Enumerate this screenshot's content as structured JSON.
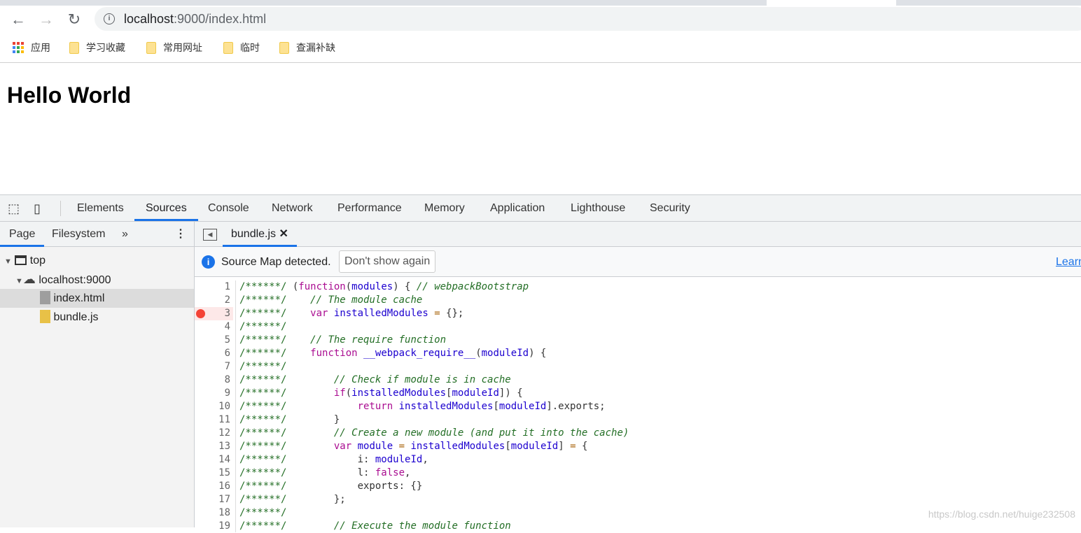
{
  "browser": {
    "url_host": "localhost",
    "url_rest": ":9000/index.html",
    "bookmarks": [
      {
        "label": "应用",
        "icon": "apps-icon"
      },
      {
        "label": "学习收藏",
        "icon": "folder-icon"
      },
      {
        "label": "常用网址",
        "icon": "folder-icon"
      },
      {
        "label": "临时",
        "icon": "folder-icon"
      },
      {
        "label": "查漏补缺",
        "icon": "folder-icon"
      }
    ]
  },
  "page": {
    "heading": "Hello World"
  },
  "devtools": {
    "tabs": [
      "Elements",
      "Sources",
      "Console",
      "Network",
      "Performance",
      "Memory",
      "Application",
      "Lighthouse",
      "Security"
    ],
    "active_tab": "Sources",
    "navigator_tabs": [
      "Page",
      "Filesystem"
    ],
    "tree": [
      {
        "label": "top"
      },
      {
        "label": "localhost:9000"
      },
      {
        "label": "index.html"
      },
      {
        "label": "bundle.js"
      }
    ],
    "open_file": "bundle.js",
    "sourcemap": {
      "message": "Source Map detected.",
      "button": "Don't show again",
      "link": "Learn"
    },
    "breakpoint_line": 3,
    "code": [
      [
        [
          "p",
          "("
        ],
        [
          "k",
          "function"
        ],
        [
          "p",
          "("
        ],
        [
          "v",
          "modules"
        ],
        [
          "p",
          ") { "
        ],
        [
          "c",
          "// webpackBootstrap"
        ]
      ],
      [
        [
          "p",
          "   "
        ],
        [
          "c",
          "// The module cache"
        ]
      ],
      [
        [
          "p",
          "   "
        ],
        [
          "k",
          "var"
        ],
        [
          "p",
          " "
        ],
        [
          "v",
          "installedModules"
        ],
        [
          "p",
          " "
        ],
        [
          "o",
          "="
        ],
        [
          "p",
          " {};"
        ]
      ],
      [],
      [
        [
          "p",
          "   "
        ],
        [
          "c",
          "// The require function"
        ]
      ],
      [
        [
          "p",
          "   "
        ],
        [
          "k",
          "function"
        ],
        [
          "p",
          " "
        ],
        [
          "v",
          "__webpack_require__"
        ],
        [
          "p",
          "("
        ],
        [
          "v",
          "moduleId"
        ],
        [
          "p",
          ") {"
        ]
      ],
      [],
      [
        [
          "p",
          "       "
        ],
        [
          "c",
          "// Check if module is in cache"
        ]
      ],
      [
        [
          "p",
          "       "
        ],
        [
          "k",
          "if"
        ],
        [
          "p",
          "("
        ],
        [
          "v",
          "installedModules"
        ],
        [
          "p",
          "["
        ],
        [
          "v",
          "moduleId"
        ],
        [
          "p",
          "]) {"
        ]
      ],
      [
        [
          "p",
          "           "
        ],
        [
          "k",
          "return"
        ],
        [
          "p",
          " "
        ],
        [
          "v",
          "installedModules"
        ],
        [
          "p",
          "["
        ],
        [
          "v",
          "moduleId"
        ],
        [
          "p",
          "].exports;"
        ]
      ],
      [
        [
          "p",
          "       }"
        ]
      ],
      [
        [
          "p",
          "       "
        ],
        [
          "c",
          "// Create a new module (and put it into the cache)"
        ]
      ],
      [
        [
          "p",
          "       "
        ],
        [
          "k",
          "var"
        ],
        [
          "p",
          " "
        ],
        [
          "v",
          "module"
        ],
        [
          "p",
          " "
        ],
        [
          "o",
          "="
        ],
        [
          "p",
          " "
        ],
        [
          "v",
          "installedModules"
        ],
        [
          "p",
          "["
        ],
        [
          "v",
          "moduleId"
        ],
        [
          "p",
          "] "
        ],
        [
          "o",
          "="
        ],
        [
          "p",
          " {"
        ]
      ],
      [
        [
          "p",
          "           i: "
        ],
        [
          "v",
          "moduleId"
        ],
        [
          "p",
          ","
        ]
      ],
      [
        [
          "p",
          "           l: "
        ],
        [
          "k",
          "false"
        ],
        [
          "p",
          ","
        ]
      ],
      [
        [
          "p",
          "           exports: {}"
        ]
      ],
      [
        [
          "p",
          "       };"
        ]
      ],
      [],
      [
        [
          "p",
          "       "
        ],
        [
          "c",
          "// Execute the module function"
        ]
      ]
    ],
    "watermark": "https://blog.csdn.net/huige232508"
  }
}
